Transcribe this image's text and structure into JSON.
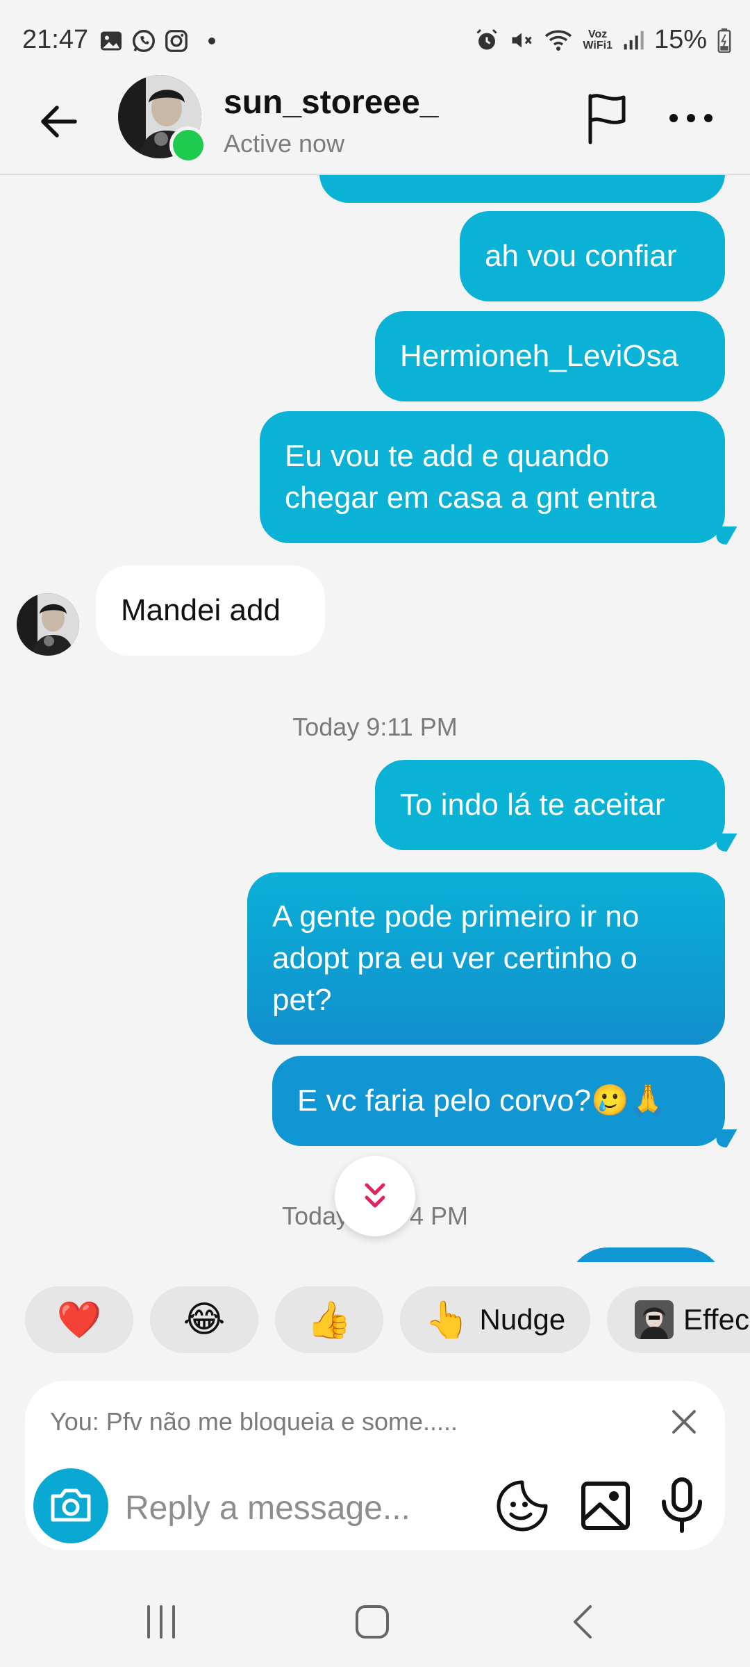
{
  "status_bar": {
    "time": "21:47",
    "battery": "15%",
    "wifi_label_top": "Voz",
    "wifi_label_bottom": "WiFi1",
    "left_icons": [
      "gallery-icon",
      "whatsapp-icon",
      "instagram-icon",
      "dot-icon"
    ],
    "right_icons": [
      "alarm-icon",
      "mute-icon",
      "wifi-icon",
      "signal-icon",
      "battery-icon"
    ]
  },
  "header": {
    "username": "sun_storeee_",
    "status": "Active now",
    "online_color": "#1ecb4f"
  },
  "messages": [
    {
      "direction": "out",
      "text": ""
    },
    {
      "direction": "out",
      "text": "ah vou confiar"
    },
    {
      "direction": "out",
      "text": "Hermioneh_LeviOsa"
    },
    {
      "direction": "out",
      "lines": [
        "Eu vou te add e quando",
        "chegar em casa a gnt entra"
      ]
    },
    {
      "direction": "in",
      "text": "Mandei add"
    },
    {
      "type": "timestamp",
      "text": "Today 9:11 PM"
    },
    {
      "direction": "out",
      "text": "To indo lá te aceitar"
    },
    {
      "direction": "out",
      "lines": [
        "A gente pode primeiro ir no",
        "adopt pra eu ver certinho o",
        "pet?"
      ]
    },
    {
      "direction": "out",
      "text": "E vc faria pelo corvo?🥲🙏"
    },
    {
      "type": "timestamp",
      "text": "Today",
      "text_tail": "4 PM"
    },
    {
      "direction": "out",
      "text": ""
    }
  ],
  "reactions": [
    {
      "emoji": "❤️",
      "label": ""
    },
    {
      "emoji": "😂",
      "label": ""
    },
    {
      "emoji": "👍",
      "label": ""
    },
    {
      "emoji": "👆",
      "label": "Nudge"
    },
    {
      "emoji": "",
      "label": "Effec"
    }
  ],
  "composer": {
    "reply_preview": "You: Pfv não me bloqueia e some.....",
    "placeholder": "Reply a message..."
  },
  "colors": {
    "bubble_cyan": "#0ab3d6",
    "bubble_blue": "#1096d2",
    "accent": "#0aa9d3",
    "scroll_arrow": "#e0245e"
  }
}
